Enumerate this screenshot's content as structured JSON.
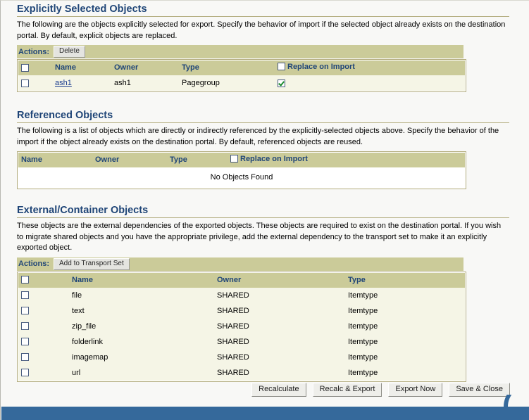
{
  "sections": [
    {
      "id": "explicitly-selected",
      "title": "Explicitly Selected Objects",
      "description": "The following are the objects explicitly selected for export. Specify the behavior of import if the selected object already exists on the destination portal. By default, explicit objects are replaced.",
      "actions_label": "Actions:",
      "action_button": "Delete",
      "columns": [
        "",
        "Name",
        "Owner",
        "Type",
        "Replace on Import"
      ],
      "rows": [
        {
          "selected": false,
          "name": "ash1",
          "owner": "ash1",
          "type": "Pagegroup",
          "replace_on_import": true
        }
      ]
    },
    {
      "id": "referenced",
      "title": "Referenced Objects",
      "description": "The following is a list of objects which are directly or indirectly referenced by the explicitly-selected objects above. Specify the behavior of the import if the object already exists on the destination portal. By default, referenced objects are reused.",
      "columns": [
        "Name",
        "Owner",
        "Type",
        "Replace on Import"
      ],
      "empty_message": "No Objects Found"
    },
    {
      "id": "external-container",
      "title": "External/Container Objects",
      "description": "These objects are the external dependencies of the exported objects. These objects are required to exist on the destination portal. If you wish to migrate shared objects and you have the appropriate privilege, add the external dependency to the transport set to make it an explicitly exported object.",
      "actions_label": "Actions:",
      "action_button": "Add to Transport Set",
      "columns": [
        "",
        "Name",
        "Owner",
        "Type"
      ],
      "rows": [
        {
          "selected": false,
          "name": "file",
          "owner": "SHARED",
          "type": "Itemtype"
        },
        {
          "selected": false,
          "name": "text",
          "owner": "SHARED",
          "type": "Itemtype"
        },
        {
          "selected": false,
          "name": "zip_file",
          "owner": "SHARED",
          "type": "Itemtype"
        },
        {
          "selected": false,
          "name": "folderlink",
          "owner": "SHARED",
          "type": "Itemtype"
        },
        {
          "selected": false,
          "name": "imagemap",
          "owner": "SHARED",
          "type": "Itemtype"
        },
        {
          "selected": false,
          "name": "url",
          "owner": "SHARED",
          "type": "Itemtype"
        }
      ]
    }
  ],
  "footer": {
    "buttons": [
      "Recalculate",
      "Recalc & Export",
      "Export Now",
      "Save & Close"
    ]
  },
  "colors": {
    "heading": "#1f4577",
    "header_bar": "#cbcb99",
    "row_bg": "#f5f5e6",
    "rule": "#b3ac7e",
    "footer_bar": "#35699b",
    "link": "#1a3d8f",
    "check": "#1a8a2e"
  }
}
